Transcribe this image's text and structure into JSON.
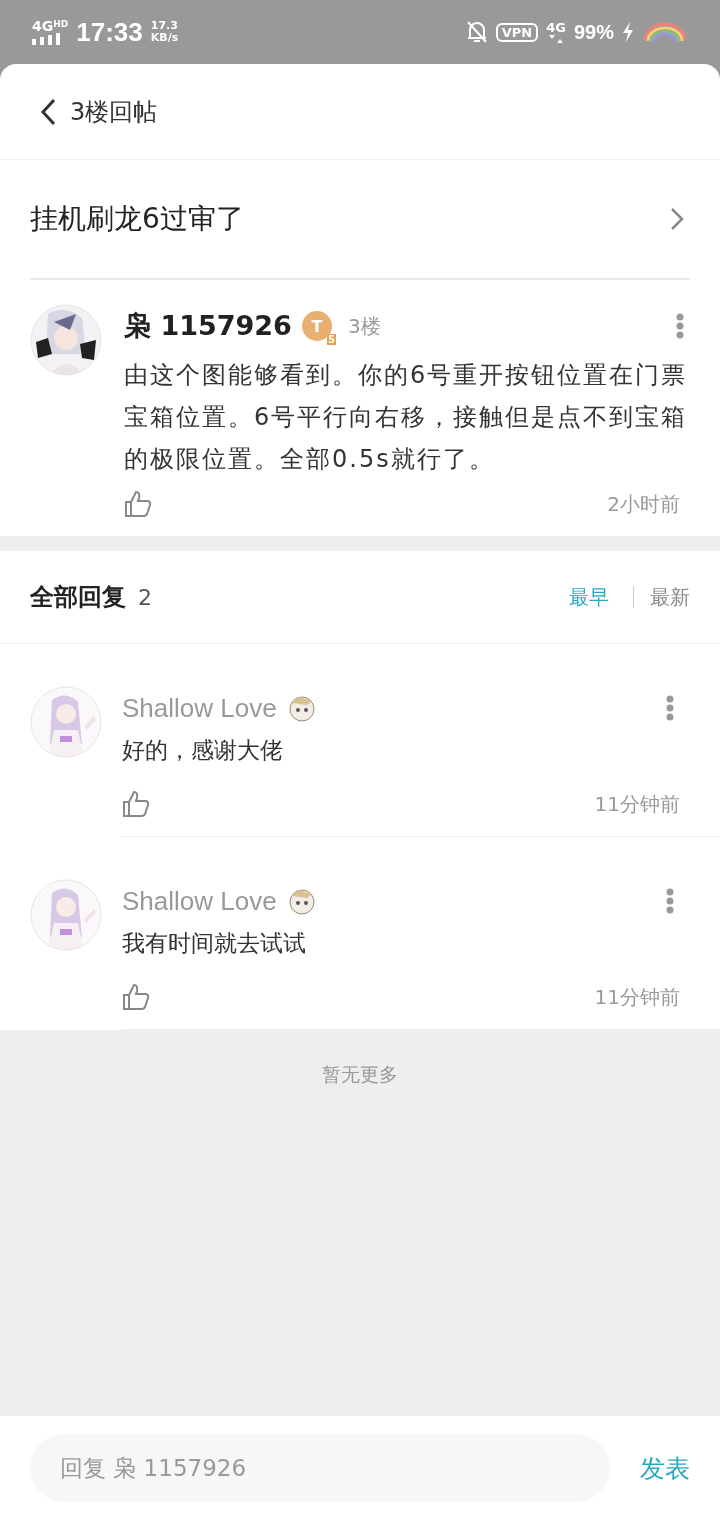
{
  "status_bar": {
    "network": "4G",
    "network_badge": "HD",
    "time": "17:33",
    "speed_value": "17.3",
    "speed_unit": "KB/s",
    "vpn": "VPN",
    "mobile": "4G",
    "battery": "99%"
  },
  "header": {
    "back": "3楼回帖"
  },
  "thread": {
    "title": "挂机刷龙6过审了"
  },
  "post": {
    "author": "枭 1157926",
    "badge_letter": "T",
    "badge_level": "5",
    "floor": "3楼",
    "content": "由这个图能够看到。你的6号重开按钮位置在门票宝箱位置。6号平行向右移，接触但是点不到宝箱的极限位置。全部0.5s就行了。",
    "time": "2小时前"
  },
  "replies_header": {
    "title": "全部回复",
    "count": "2",
    "sorts": [
      {
        "label": "最早",
        "selected": true
      },
      {
        "label": "最新",
        "selected": false
      }
    ]
  },
  "replies": [
    {
      "author": "Shallow  Love",
      "content": "好的，感谢大佬",
      "time": "11分钟前"
    },
    {
      "author": "Shallow  Love",
      "content": "我有时间就去试试",
      "time": "11分钟前"
    }
  ],
  "end_note": "暂无更多",
  "composer": {
    "placeholder": "回复 枭 1157926",
    "send": "发表"
  }
}
